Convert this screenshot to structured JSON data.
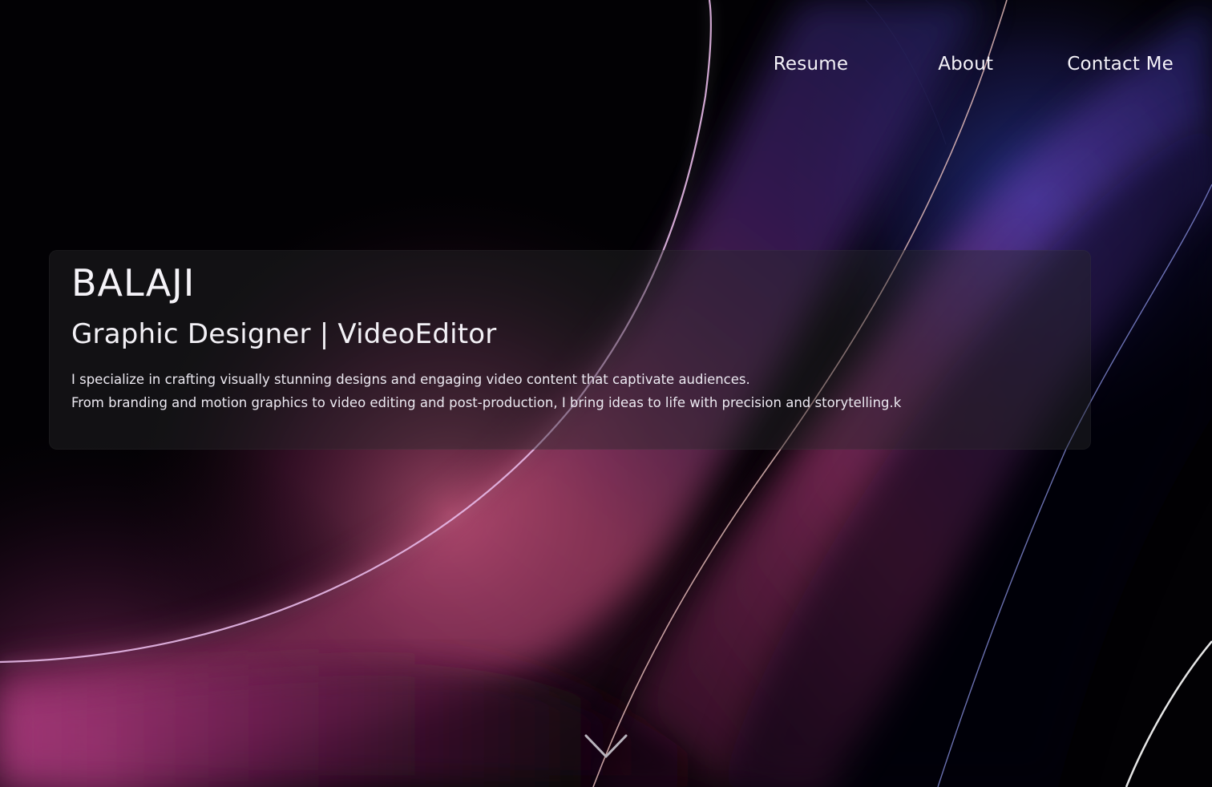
{
  "nav": {
    "items": [
      {
        "label": "Resume"
      },
      {
        "label": "About"
      },
      {
        "label": "Contact Me"
      }
    ]
  },
  "hero": {
    "name": "BALAJI",
    "role": "Graphic Designer | VideoEditor",
    "description_lines": [
      "I specialize in crafting visually stunning designs and engaging video content that captivate audiences.",
      "From branding and motion graphics to video editing and post-production, I bring ideas to life with precision and storytelling.k"
    ]
  },
  "scroll": {
    "icon": "chevron-down-icon"
  },
  "colors": {
    "background": "#000000",
    "accent_pink": "#c2407e",
    "accent_purple": "#6a3aa8",
    "accent_blue": "#2a3a9a",
    "text": "#f4f2f8"
  }
}
